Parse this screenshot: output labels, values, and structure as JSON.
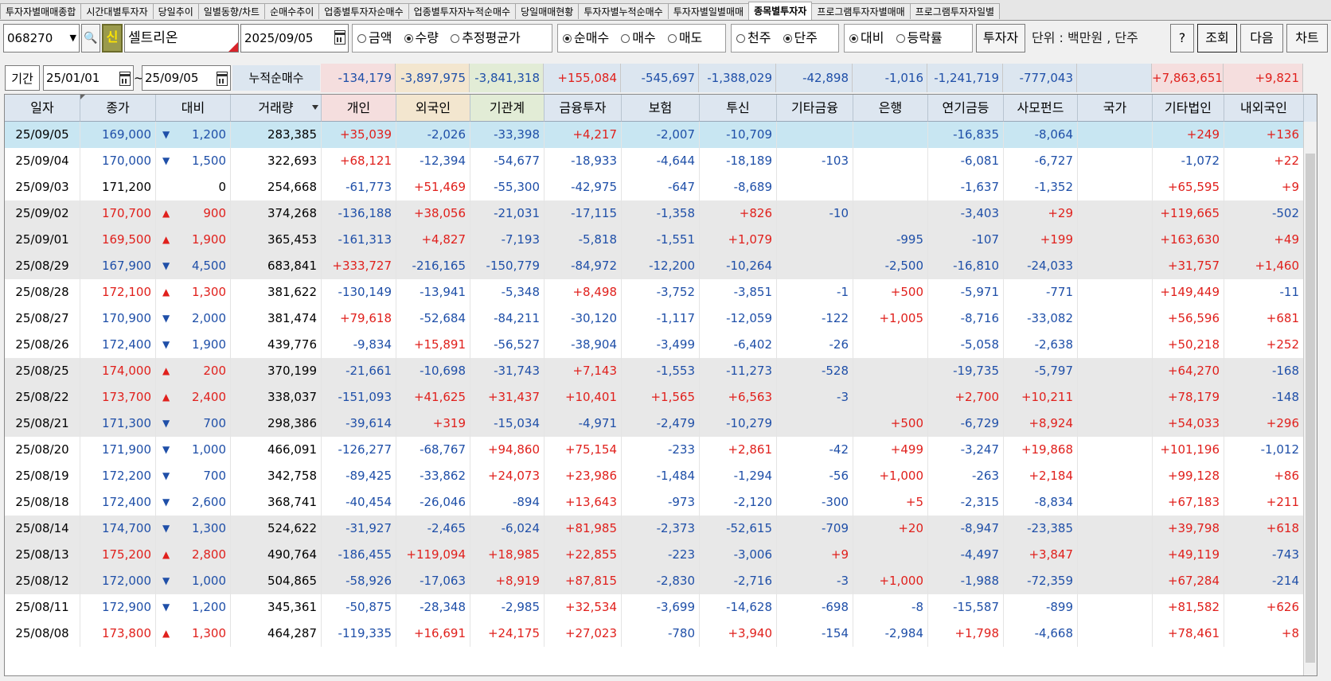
{
  "tabs": [
    {
      "label": "투자자별매매종합",
      "active": false
    },
    {
      "label": "시간대별투자자",
      "active": false
    },
    {
      "label": "당일추이",
      "active": false
    },
    {
      "label": "일별동향/차트",
      "active": false
    },
    {
      "label": "순매수추이",
      "active": false
    },
    {
      "label": "업종별투자자순매수",
      "active": false
    },
    {
      "label": "업종별투자자누적순매수",
      "active": false
    },
    {
      "label": "당일매매현황",
      "active": false
    },
    {
      "label": "투자자별누적순매수",
      "active": false
    },
    {
      "label": "투자자별일별매매",
      "active": false
    },
    {
      "label": "종목별투자자",
      "active": true
    },
    {
      "label": "프로그램투자자별매매",
      "active": false
    },
    {
      "label": "프로그램투자자일별",
      "active": false
    }
  ],
  "controls": {
    "code": "068270",
    "shin": "신",
    "name": "셀트리온",
    "date": "2025/09/05",
    "group1": [
      "금액",
      "수량",
      "추정평균가"
    ],
    "group2": [
      "순매수",
      "매수",
      "매도"
    ],
    "group3": [
      "천주",
      "단주"
    ],
    "group4": [
      "대비",
      "등락률"
    ],
    "investor_btn": "투자자",
    "unit_label": "단위 : 백만원 , 단주",
    "help_btn": "?",
    "query_btn": "조회",
    "next_btn": "다음",
    "chart_btn": "차트"
  },
  "period": {
    "label": "기간",
    "from": "25/01/01",
    "tilde": "~",
    "to": "25/09/05",
    "cum_label": "누적순매수",
    "cum_values": [
      "-134,179",
      "-3,897,975",
      "-3,841,318",
      "+155,084",
      "-545,697",
      "-1,388,029",
      "-42,898",
      "-1,016",
      "-1,241,719",
      "-777,043",
      "",
      "+7,863,651",
      "+9,821"
    ]
  },
  "columns": [
    "일자",
    "종가",
    "대비",
    "거래량",
    "개인",
    "외국인",
    "기관계",
    "금융투자",
    "보험",
    "투신",
    "기타금융",
    "은행",
    "연기금등",
    "사모펀드",
    "국가",
    "기타법인",
    "내외국인"
  ],
  "rows": [
    {
      "date": "25/09/05",
      "close": "169,000",
      "dir": "down",
      "diff": "1,200",
      "vol": "283,385",
      "v": [
        "+35,039",
        "-2,026",
        "-33,398",
        "+4,217",
        "-2,007",
        "-10,709",
        "",
        "",
        "-16,835",
        "-8,064",
        "",
        "+249",
        "+136"
      ]
    },
    {
      "date": "25/09/04",
      "close": "170,000",
      "dir": "down",
      "diff": "1,500",
      "vol": "322,693",
      "v": [
        "+68,121",
        "-12,394",
        "-54,677",
        "-18,933",
        "-4,644",
        "-18,189",
        "-103",
        "",
        "-6,081",
        "-6,727",
        "",
        "-1,072",
        "+22"
      ]
    },
    {
      "date": "25/09/03",
      "close": "171,200",
      "dir": "flat",
      "diff": "0",
      "vol": "254,668",
      "v": [
        "-61,773",
        "+51,469",
        "-55,300",
        "-42,975",
        "-647",
        "-8,689",
        "",
        "",
        "-1,637",
        "-1,352",
        "",
        "+65,595",
        "+9"
      ]
    },
    {
      "date": "25/09/02",
      "close": "170,700",
      "dir": "up",
      "diff": "900",
      "vol": "374,268",
      "v": [
        "-136,188",
        "+38,056",
        "-21,031",
        "-17,115",
        "-1,358",
        "+826",
        "-10",
        "",
        "-3,403",
        "+29",
        "",
        "+119,665",
        "-502"
      ]
    },
    {
      "date": "25/09/01",
      "close": "169,500",
      "dir": "up",
      "diff": "1,900",
      "vol": "365,453",
      "v": [
        "-161,313",
        "+4,827",
        "-7,193",
        "-5,818",
        "-1,551",
        "+1,079",
        "",
        "-995",
        "-107",
        "+199",
        "",
        "+163,630",
        "+49"
      ]
    },
    {
      "date": "25/08/29",
      "close": "167,900",
      "dir": "down",
      "diff": "4,500",
      "vol": "683,841",
      "v": [
        "+333,727",
        "-216,165",
        "-150,779",
        "-84,972",
        "-12,200",
        "-10,264",
        "",
        "-2,500",
        "-16,810",
        "-24,033",
        "",
        "+31,757",
        "+1,460"
      ]
    },
    {
      "date": "25/08/28",
      "close": "172,100",
      "dir": "up",
      "diff": "1,300",
      "vol": "381,622",
      "v": [
        "-130,149",
        "-13,941",
        "-5,348",
        "+8,498",
        "-3,752",
        "-3,851",
        "-1",
        "+500",
        "-5,971",
        "-771",
        "",
        "+149,449",
        "-11"
      ]
    },
    {
      "date": "25/08/27",
      "close": "170,900",
      "dir": "down",
      "diff": "2,000",
      "vol": "381,474",
      "v": [
        "+79,618",
        "-52,684",
        "-84,211",
        "-30,120",
        "-1,117",
        "-12,059",
        "-122",
        "+1,005",
        "-8,716",
        "-33,082",
        "",
        "+56,596",
        "+681"
      ]
    },
    {
      "date": "25/08/26",
      "close": "172,400",
      "dir": "down",
      "diff": "1,900",
      "vol": "439,776",
      "v": [
        "-9,834",
        "+15,891",
        "-56,527",
        "-38,904",
        "-3,499",
        "-6,402",
        "-26",
        "",
        "-5,058",
        "-2,638",
        "",
        "+50,218",
        "+252"
      ]
    },
    {
      "date": "25/08/25",
      "close": "174,000",
      "dir": "up",
      "diff": "200",
      "vol": "370,199",
      "v": [
        "-21,661",
        "-10,698",
        "-31,743",
        "+7,143",
        "-1,553",
        "-11,273",
        "-528",
        "",
        "-19,735",
        "-5,797",
        "",
        "+64,270",
        "-168"
      ]
    },
    {
      "date": "25/08/22",
      "close": "173,700",
      "dir": "up",
      "diff": "2,400",
      "vol": "338,037",
      "v": [
        "-151,093",
        "+41,625",
        "+31,437",
        "+10,401",
        "+1,565",
        "+6,563",
        "-3",
        "",
        "+2,700",
        "+10,211",
        "",
        "+78,179",
        "-148"
      ]
    },
    {
      "date": "25/08/21",
      "close": "171,300",
      "dir": "down",
      "diff": "700",
      "vol": "298,386",
      "v": [
        "-39,614",
        "+319",
        "-15,034",
        "-4,971",
        "-2,479",
        "-10,279",
        "",
        "+500",
        "-6,729",
        "+8,924",
        "",
        "+54,033",
        "+296"
      ]
    },
    {
      "date": "25/08/20",
      "close": "171,900",
      "dir": "down",
      "diff": "1,000",
      "vol": "466,091",
      "v": [
        "-126,277",
        "-68,767",
        "+94,860",
        "+75,154",
        "-233",
        "+2,861",
        "-42",
        "+499",
        "-3,247",
        "+19,868",
        "",
        "+101,196",
        "-1,012"
      ]
    },
    {
      "date": "25/08/19",
      "close": "172,200",
      "dir": "down",
      "diff": "700",
      "vol": "342,758",
      "v": [
        "-89,425",
        "-33,862",
        "+24,073",
        "+23,986",
        "-1,484",
        "-1,294",
        "-56",
        "+1,000",
        "-263",
        "+2,184",
        "",
        "+99,128",
        "+86"
      ]
    },
    {
      "date": "25/08/18",
      "close": "172,400",
      "dir": "down",
      "diff": "2,600",
      "vol": "368,741",
      "v": [
        "-40,454",
        "-26,046",
        "-894",
        "+13,643",
        "-973",
        "-2,120",
        "-300",
        "+5",
        "-2,315",
        "-8,834",
        "",
        "+67,183",
        "+211"
      ]
    },
    {
      "date": "25/08/14",
      "close": "174,700",
      "dir": "down",
      "diff": "1,300",
      "vol": "524,622",
      "v": [
        "-31,927",
        "-2,465",
        "-6,024",
        "+81,985",
        "-2,373",
        "-52,615",
        "-709",
        "+20",
        "-8,947",
        "-23,385",
        "",
        "+39,798",
        "+618"
      ]
    },
    {
      "date": "25/08/13",
      "close": "175,200",
      "dir": "up",
      "diff": "2,800",
      "vol": "490,764",
      "v": [
        "-186,455",
        "+119,094",
        "+18,985",
        "+22,855",
        "-223",
        "-3,006",
        "+9",
        "",
        "-4,497",
        "+3,847",
        "",
        "+49,119",
        "-743"
      ]
    },
    {
      "date": "25/08/12",
      "close": "172,000",
      "dir": "down",
      "diff": "1,000",
      "vol": "504,865",
      "v": [
        "-58,926",
        "-17,063",
        "+8,919",
        "+87,815",
        "-2,830",
        "-2,716",
        "-3",
        "+1,000",
        "-1,988",
        "-72,359",
        "",
        "+67,284",
        "-214"
      ]
    },
    {
      "date": "25/08/11",
      "close": "172,900",
      "dir": "down",
      "diff": "1,200",
      "vol": "345,361",
      "v": [
        "-50,875",
        "-28,348",
        "-2,985",
        "+32,534",
        "-3,699",
        "-14,628",
        "-698",
        "-8",
        "-15,587",
        "-899",
        "",
        "+81,582",
        "+626"
      ]
    },
    {
      "date": "25/08/08",
      "close": "173,800",
      "dir": "up",
      "diff": "1,300",
      "vol": "464,287",
      "v": [
        "-119,335",
        "+16,691",
        "+24,175",
        "+27,023",
        "-780",
        "+3,940",
        "-154",
        "-2,984",
        "+1,798",
        "-4,668",
        "",
        "+78,461",
        "+8"
      ]
    }
  ],
  "colors": {
    "up": "#e0201c",
    "down": "#1f4fa8",
    "selected": "#c8e6f2",
    "band": "#e8e8e8",
    "header": "#dde6f0"
  }
}
